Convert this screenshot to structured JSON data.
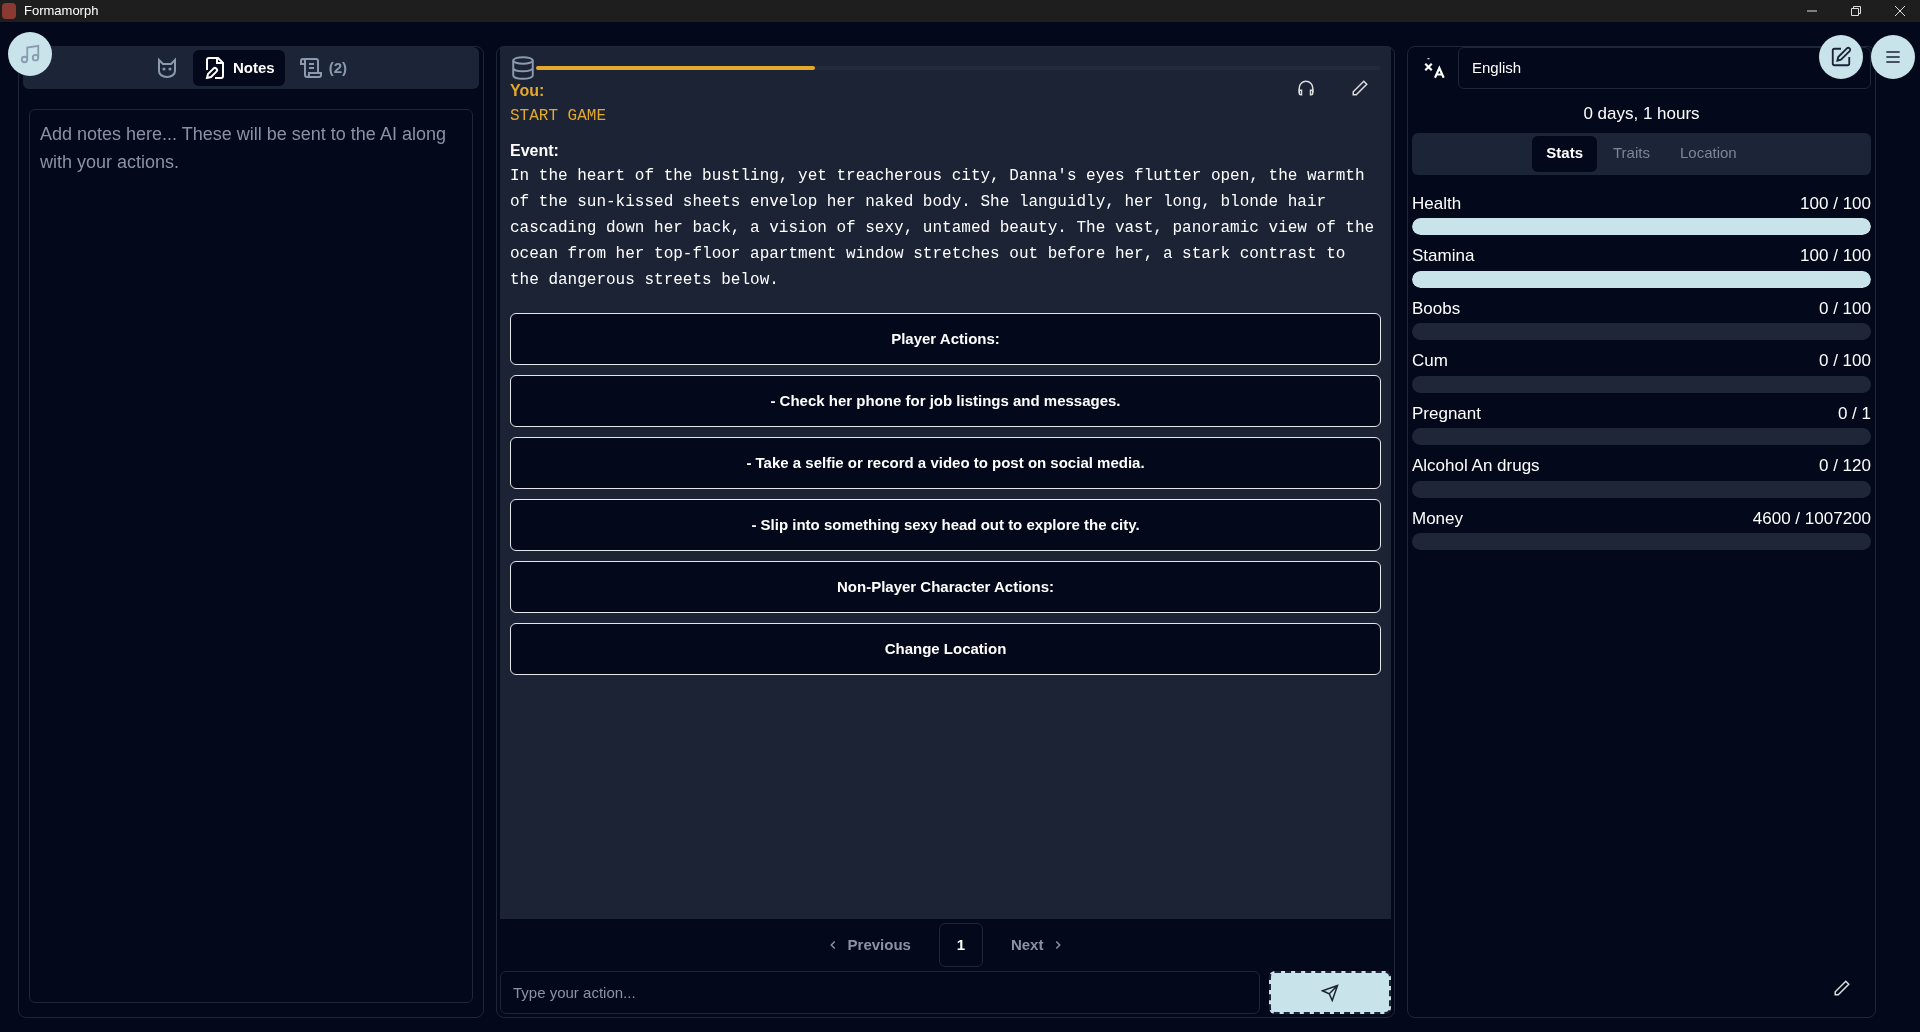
{
  "window": {
    "title": "Formamorph"
  },
  "left_panel": {
    "tabs": [
      {
        "kind": "cat",
        "selected": false
      },
      {
        "kind": "notes",
        "label": "Notes",
        "selected": true
      },
      {
        "kind": "scroll",
        "label": "(2)",
        "selected": false
      }
    ],
    "notes": {
      "placeholder": "Add notes here... These will be sent to the AI along with your actions."
    }
  },
  "story": {
    "progress": {
      "level": 0.33
    },
    "messages": [
      {
        "speaker": "You:",
        "text": "START GAME",
        "kind": "player"
      },
      {
        "speaker": "Event:",
        "text": "In the heart of the bustling, yet treacherous city, Danna's eyes flutter open, the warmth of the sun-kissed sheets envelop her naked body. She languidly, her long, blonde hair cascading down her back, a vision of sexy, untamed beauty. The vast, panoramic view of the ocean from her top-floor apartment window stretches out before her, a stark contrast to the dangerous streets below.",
        "kind": "event"
      }
    ],
    "actions": [
      "Player Actions:",
      "- Check her phone for job listings and messages.",
      "- Take a selfie or record a video to post on social media.",
      "- Slip into something sexy head out to explore the city.",
      "Non-Player Character Actions:",
      "Change Location"
    ],
    "pagination": {
      "previous": "Previous",
      "page": "1",
      "next": "Next"
    },
    "input": {
      "placeholder": "Type your action..."
    }
  },
  "right_panel": {
    "language": "English",
    "time": "0 days, 1 hours",
    "tabs": [
      {
        "label": "Stats",
        "selected": true
      },
      {
        "label": "Traits",
        "selected": false
      },
      {
        "label": "Location",
        "selected": false
      }
    ],
    "stats": [
      {
        "name": "Health",
        "reading": "100 / 100",
        "level": 1
      },
      {
        "name": "Stamina",
        "reading": "100 / 100",
        "level": 1
      },
      {
        "name": "Boobs",
        "reading": "0 / 100",
        "level": 0
      },
      {
        "name": "Cum",
        "reading": "0 / 100",
        "level": 0
      },
      {
        "name": "Pregnant",
        "reading": "0 / 1",
        "level": 0
      },
      {
        "name": "Alcohol An drugs",
        "reading": "0 / 120",
        "level": 0
      },
      {
        "name": "Money",
        "reading": "4600 / 1007200",
        "level": 0
      }
    ]
  }
}
